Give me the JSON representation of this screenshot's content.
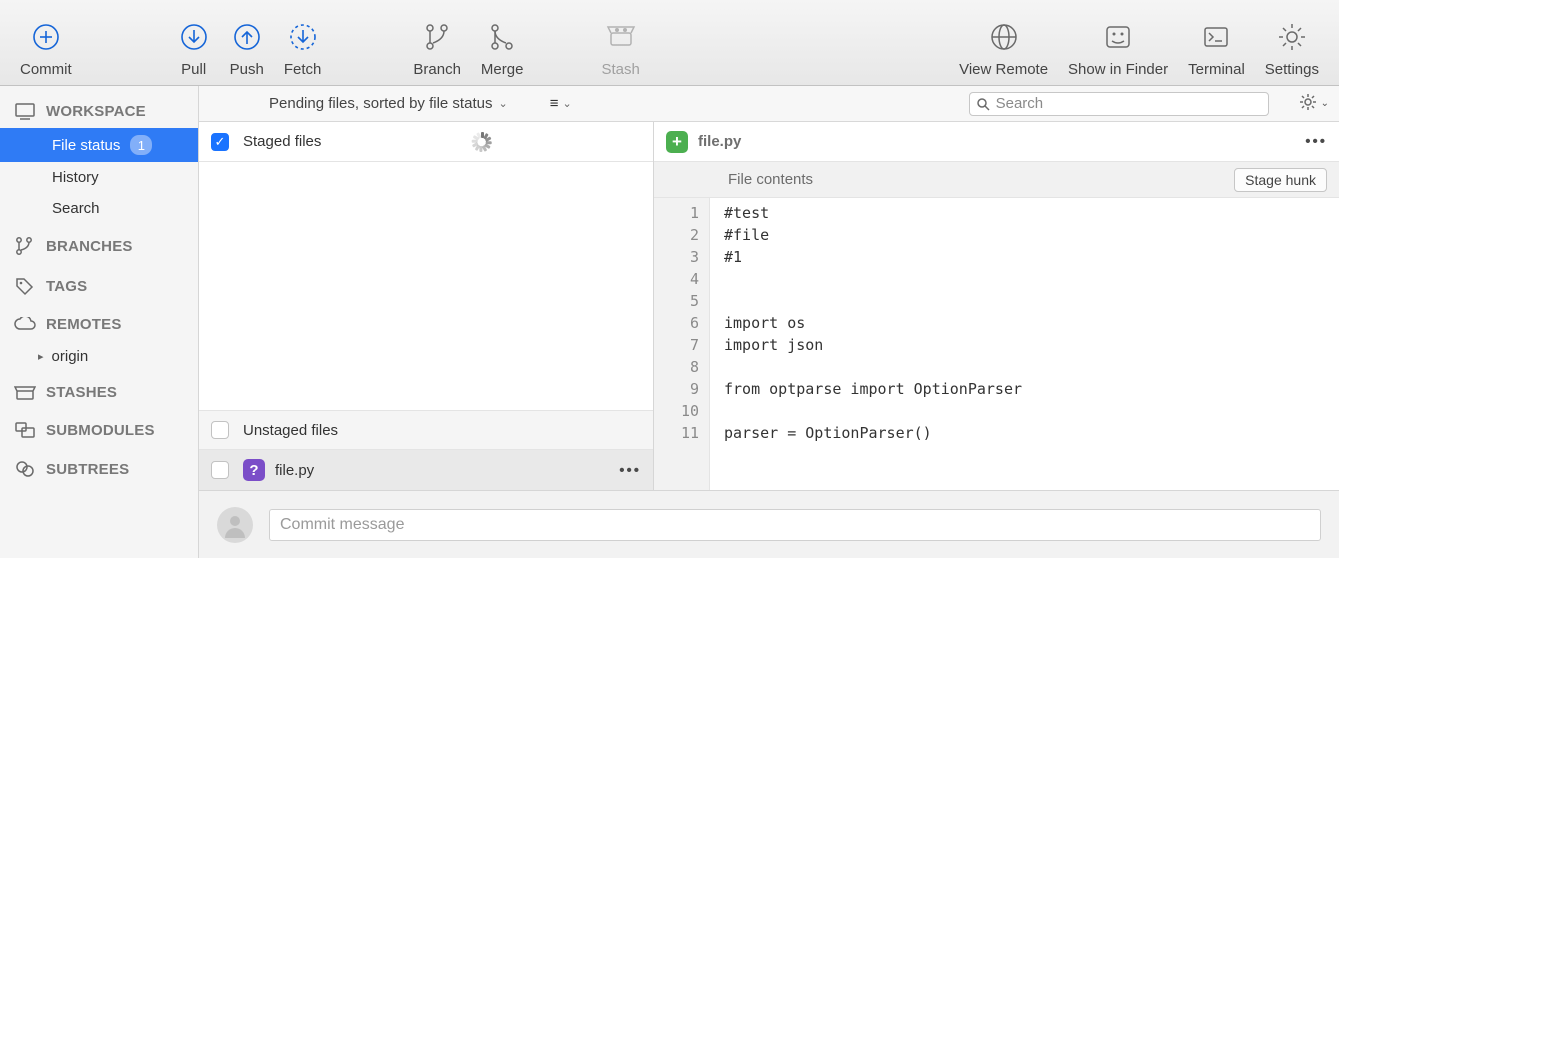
{
  "toolbar": {
    "left": [
      {
        "id": "commit",
        "label": "Commit"
      },
      {
        "id": "pull",
        "label": "Pull"
      },
      {
        "id": "push",
        "label": "Push"
      },
      {
        "id": "fetch",
        "label": "Fetch"
      },
      {
        "id": "branch",
        "label": "Branch"
      },
      {
        "id": "merge",
        "label": "Merge"
      },
      {
        "id": "stash",
        "label": "Stash",
        "disabled": true
      }
    ],
    "right": [
      {
        "id": "view-remote",
        "label": "View Remote"
      },
      {
        "id": "show-finder",
        "label": "Show in Finder"
      },
      {
        "id": "terminal",
        "label": "Terminal"
      },
      {
        "id": "settings",
        "label": "Settings"
      }
    ]
  },
  "filterbar": {
    "pending": "Pending files, sorted by file status",
    "search_placeholder": "Search"
  },
  "sidebar": {
    "workspace": {
      "title": "WORKSPACE",
      "items": [
        {
          "label": "File status",
          "badge": "1",
          "active": true
        },
        {
          "label": "History"
        },
        {
          "label": "Search"
        }
      ]
    },
    "branches": {
      "title": "BRANCHES"
    },
    "tags": {
      "title": "TAGS"
    },
    "remotes": {
      "title": "REMOTES",
      "items": [
        {
          "label": "origin"
        }
      ]
    },
    "stashes": {
      "title": "STASHES"
    },
    "submodules": {
      "title": "SUBMODULES"
    },
    "subtrees": {
      "title": "SUBTREES"
    }
  },
  "files": {
    "staged_header": "Staged files",
    "unstaged_header": "Unstaged files",
    "unstaged": [
      {
        "name": "file.py",
        "badge": "?"
      }
    ]
  },
  "diff": {
    "filename": "file.py",
    "section": "File contents",
    "stagehunk": "Stage hunk",
    "lines": [
      {
        "n": 1,
        "t": "#test"
      },
      {
        "n": 2,
        "t": "#file"
      },
      {
        "n": 3,
        "t": "#1"
      },
      {
        "n": 4,
        "t": ""
      },
      {
        "n": 5,
        "t": ""
      },
      {
        "n": 6,
        "t": "import os"
      },
      {
        "n": 7,
        "t": "import json"
      },
      {
        "n": 8,
        "t": ""
      },
      {
        "n": 9,
        "t": "from optparse import OptionParser"
      },
      {
        "n": 10,
        "t": ""
      },
      {
        "n": 11,
        "t": "parser = OptionParser()"
      }
    ]
  },
  "commit": {
    "placeholder": "Commit message"
  }
}
